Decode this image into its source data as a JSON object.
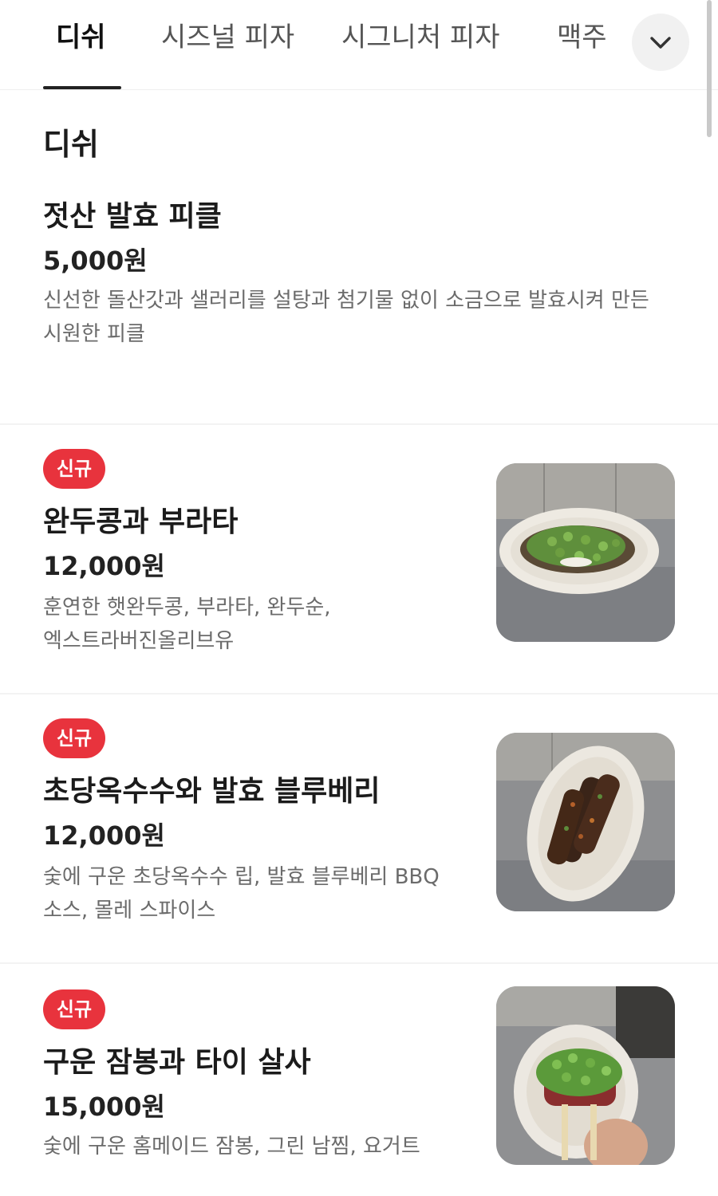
{
  "tabs": [
    {
      "label": "디쉬",
      "active": true
    },
    {
      "label": "시즈널 피자",
      "active": false
    },
    {
      "label": "시그니처 피자",
      "active": false
    },
    {
      "label": "맥주",
      "active": false
    }
  ],
  "more_icon": "chevron-down-icon",
  "section": {
    "title": "디쉬"
  },
  "items": [
    {
      "name": "젓산 발효 피클",
      "price": "5,000원",
      "desc_lines": [
        "신선한 돌산갓과 샐러리를 설탕과 첨기물 없이 소금으로 발효시켜 만든",
        "시원한 피클"
      ]
    },
    {
      "badge": "신규",
      "name": "완두콩과 부라타",
      "price": "12,000원",
      "desc_lines": [
        "훈연한 햇완두콩, 부라타, 완두순,",
        "엑스트라버진올리브유"
      ]
    },
    {
      "badge": "신규",
      "name": "초당옥수수와 발효 블루베리",
      "price": "12,000원",
      "desc_lines": [
        "숯에 구운 초당옥수수 립, 발효 블루베리 BBQ",
        "소스, 몰레 스파이스"
      ]
    },
    {
      "badge": "신규",
      "name": "구운 잠봉과 타이 살사",
      "price": "15,000원",
      "desc_lines": [
        "숯에 구운 홈메이드 잠봉, 그린 남찜, 요거트"
      ]
    }
  ],
  "colors": {
    "badge": "#e8333d",
    "text_primary": "#1b1b1b",
    "text_secondary": "#6b6b6b"
  }
}
